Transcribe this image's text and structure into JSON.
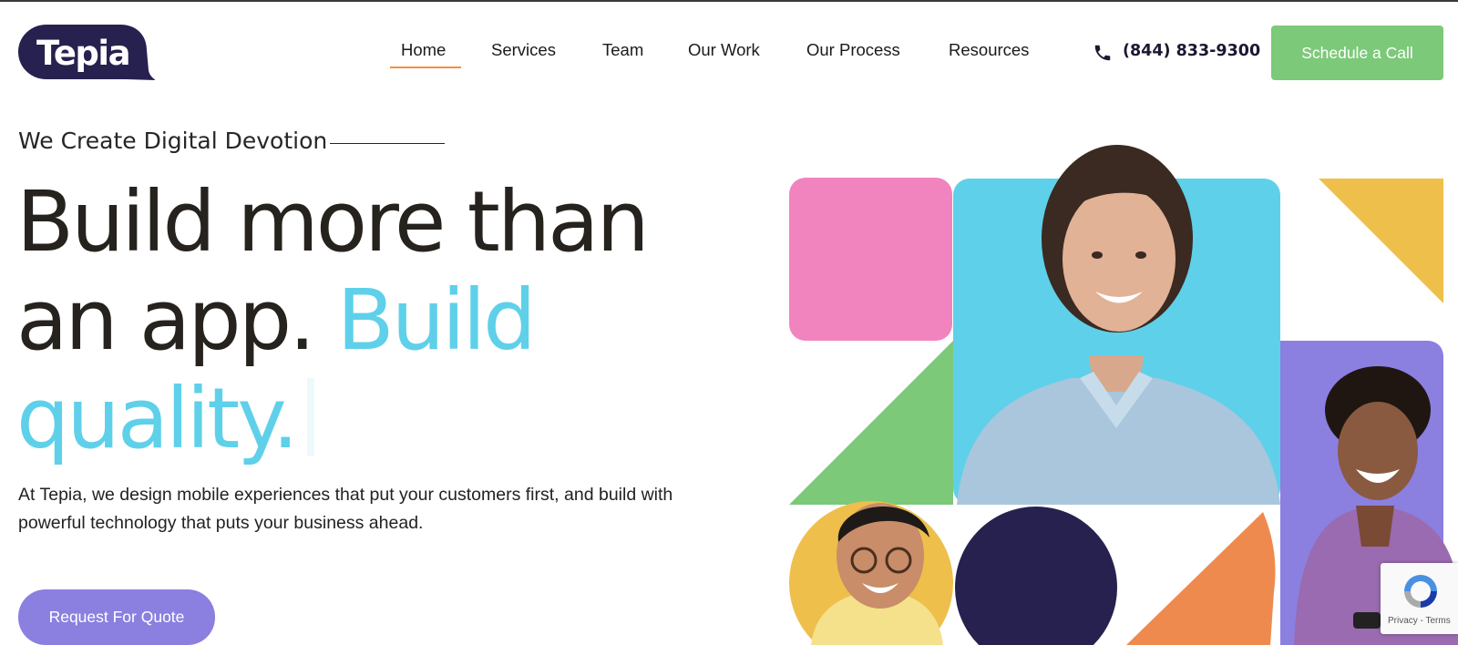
{
  "brand": {
    "name": "Tepia",
    "logo_color": "#26214f"
  },
  "nav": {
    "items": [
      {
        "label": "Home",
        "active": true
      },
      {
        "label": "Services",
        "active": false
      },
      {
        "label": "Team",
        "active": false
      },
      {
        "label": "Our Work",
        "active": false
      },
      {
        "label": "Our Process",
        "active": false
      },
      {
        "label": "Resources",
        "active": false
      }
    ],
    "active_underline_color": "#f3913d"
  },
  "contact": {
    "phone": "(844) 833-9300",
    "icon": "phone-icon"
  },
  "header_cta": {
    "label": "Schedule a Call",
    "color": "#7cc97a"
  },
  "hero": {
    "eyebrow": "We Create Digital Devotion",
    "headline_line1": "Build more than",
    "headline_line2_dark": "an app.",
    "headline_line2_accent": "Build",
    "headline_line3_accent": "quality.",
    "accent_color": "#5fd0e9",
    "description": "At Tepia, we design mobile experiences that put your customers first, and build with powerful technology that puts your business ahead.",
    "cta_label": "Request For Quote",
    "cta_color": "#8b7fe0"
  },
  "collage_colors": {
    "pink": "#f184bf",
    "cyan": "#5fd0e9",
    "yellow": "#eebf4a",
    "green": "#7cc97a",
    "purple": "#8b7fe0",
    "navy": "#26214f",
    "orange": "#ef8a4f"
  },
  "recaptcha": {
    "text": "Privacy - Terms"
  }
}
